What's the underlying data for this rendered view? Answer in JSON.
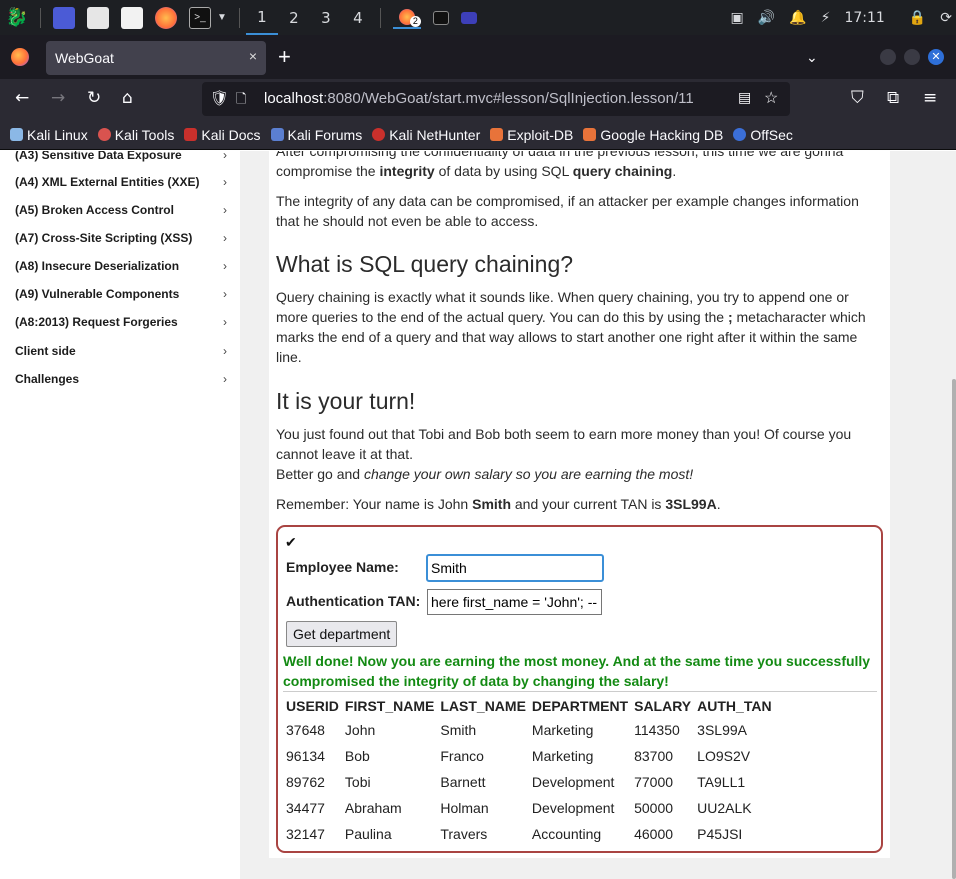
{
  "taskbar": {
    "workspaces": [
      "1",
      "2",
      "3",
      "4"
    ],
    "badge": "2",
    "clock": "17:11"
  },
  "browser": {
    "tab_title": "WebGoat",
    "tab_close": "×",
    "new_tab": "+",
    "url_host": "localhost",
    "url_rest": ":8080/WebGoat/start.mvc#lesson/SqlInjection.lesson/11",
    "bookmarks": [
      "Kali Linux",
      "Kali Tools",
      "Kali Docs",
      "Kali Forums",
      "Kali NetHunter",
      "Exploit-DB",
      "Google Hacking DB",
      "OffSec"
    ]
  },
  "sidebar": {
    "items": [
      "(A3) Sensitive Data Exposure",
      "(A4) XML External Entities (XXE)",
      "(A5) Broken Access Control",
      "(A7) Cross-Site Scripting (XSS)",
      "(A8) Insecure Deserialization",
      "(A9) Vulnerable Components",
      "(A8:2013) Request Forgeries",
      "Client side",
      "Challenges"
    ],
    "chevron": "›"
  },
  "lesson": {
    "intro_top": "After compromising the confidentiality of data in the previous lesson, this time we are gonna",
    "intro_line2_a": "compromise the ",
    "intro_line2_b": "integrity",
    "intro_line2_c": " of data by using SQL ",
    "intro_line2_d": "query chaining",
    "intro_line2_e": ".",
    "para2": "The integrity of any data can be compromised, if an attacker per example changes information that he should not even be able to access.",
    "heading1": "What is SQL query chaining?",
    "para3_a": "Query chaining is exactly what it sounds like. When query chaining, you try to append one or more queries to the end of the actual query. You can do this by using the ",
    "para3_b": ";",
    "para3_c": " metacharacter which marks the end of a query and that way allows to start another one right after it within the same line.",
    "heading2": "It is your turn!",
    "para4": "You just found out that Tobi and Bob both seem to earn more money than you! Of course you cannot leave it at that.",
    "para5_a": "Better go and ",
    "para5_b": "change your own salary so you are earning the most!",
    "para6_a": "Remember: Your name is John ",
    "para6_b": "Smith",
    "para6_c": " and your current TAN is ",
    "para6_d": "3SL99A",
    "para6_e": "."
  },
  "form": {
    "check": "✔",
    "employee_label": "Employee Name:",
    "employee_value": "Smith",
    "tan_label": "Authentication TAN:",
    "tan_value": "here first_name = 'John'; --",
    "submit": "Get department",
    "success": "Well done! Now you are earning the most money. And at the same time you successfully compromised the integrity of data by changing the salary!"
  },
  "table": {
    "headers": [
      "USERID",
      "FIRST_NAME",
      "LAST_NAME",
      "DEPARTMENT",
      "SALARY",
      "AUTH_TAN"
    ],
    "rows": [
      [
        "37648",
        "John",
        "Smith",
        "Marketing",
        "114350",
        "3SL99A"
      ],
      [
        "96134",
        "Bob",
        "Franco",
        "Marketing",
        "83700",
        "LO9S2V"
      ],
      [
        "89762",
        "Tobi",
        "Barnett",
        "Development",
        "77000",
        "TA9LL1"
      ],
      [
        "34477",
        "Abraham",
        "Holman",
        "Development",
        "50000",
        "UU2ALK"
      ],
      [
        "32147",
        "Paulina",
        "Travers",
        "Accounting",
        "46000",
        "P45JSI"
      ]
    ]
  },
  "colors": {
    "success": "#138a13",
    "form_border": "#a94442",
    "accent": "#3b8fd7"
  }
}
